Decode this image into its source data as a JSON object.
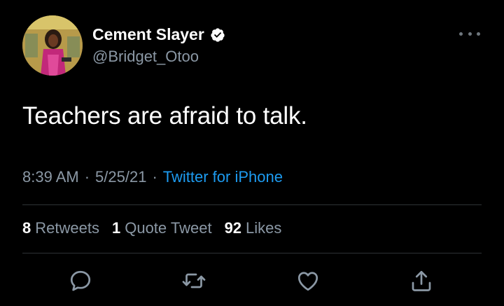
{
  "author": {
    "display_name": "Cement Slayer",
    "handle": "@Bridget_Otoo",
    "verified": true,
    "avatar_icon": "profile-photo"
  },
  "tweet": {
    "text": "Teachers are afraid to talk."
  },
  "meta": {
    "time": "8:39 AM",
    "separator": "·",
    "date": "5/25/21",
    "source": "Twitter for iPhone"
  },
  "stats": {
    "retweets_count": "8",
    "retweets_label": "Retweets",
    "quotes_count": "1",
    "quotes_label": "Quote Tweet",
    "likes_count": "92",
    "likes_label": "Likes"
  },
  "actions": {
    "reply_icon": "reply-icon",
    "retweet_icon": "retweet-icon",
    "like_icon": "heart-icon",
    "share_icon": "share-icon"
  },
  "colors": {
    "background": "#000000",
    "primary_text": "#ffffff",
    "secondary_text": "#8b98a5",
    "link": "#1d9bf0",
    "divider": "#2f3336",
    "icon": "#8b98a5"
  }
}
